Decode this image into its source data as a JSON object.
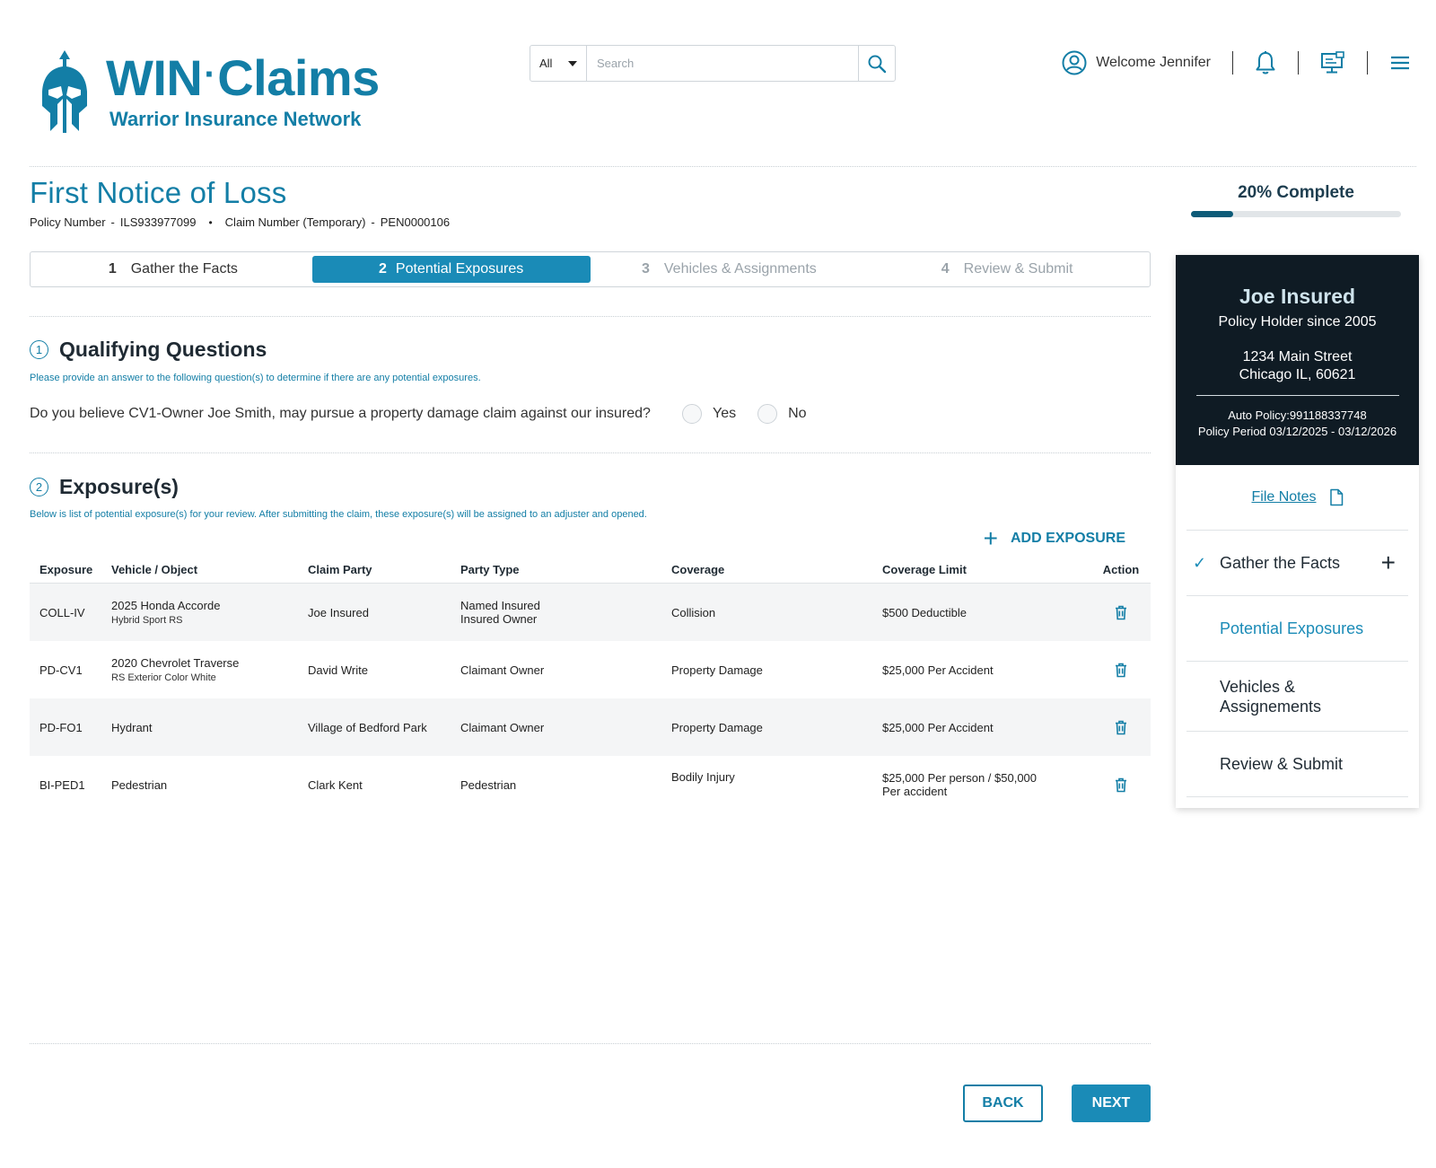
{
  "brand": {
    "title_a": "WIN",
    "title_dot": "·",
    "title_b": "Claims",
    "subtitle": "Warrior Insurance Network",
    "color": "#137ea6"
  },
  "search": {
    "scope": "All",
    "placeholder": "Search",
    "icon": "search-icon"
  },
  "user": {
    "welcome": "Welcome Jennifer",
    "icons": [
      "user-circle-icon",
      "bell-icon",
      "desktop-icon",
      "hamburger-menu-icon"
    ]
  },
  "page": {
    "title": "First Notice of Loss",
    "policy_label": "Policy Number",
    "policy_sep": "-",
    "policy_value": "ILS933977099",
    "bullet": "•",
    "claim_label": "Claim Number (Temporary)",
    "claim_sep": "-",
    "claim_value": "PEN0000106"
  },
  "progress": {
    "label": "20% Complete",
    "percent": 20
  },
  "stepper": [
    {
      "num": "1",
      "label": "Gather the Facts",
      "state": "done"
    },
    {
      "num": "2",
      "label": "Potential Exposures",
      "state": "active"
    },
    {
      "num": "3",
      "label": "Vehicles & Assignments",
      "state": "inactive"
    },
    {
      "num": "4",
      "label": "Review & Submit",
      "state": "inactive"
    }
  ],
  "qualifying": {
    "num": "1",
    "title": "Qualifying Questions",
    "description": "Please provide an answer to the following question(s) to determine if there are any potential exposures.",
    "question": "Do you believe CV1-Owner Joe Smith, may pursue a property damage claim against our insured?",
    "options": [
      "Yes",
      "No"
    ],
    "selected": null
  },
  "exposures": {
    "num": "2",
    "title": "Exposure(s)",
    "description": "Below is list of potential exposure(s) for your review. After submitting the claim, these exposure(s) will be assigned to an adjuster and opened.",
    "add_label": "ADD EXPOSURE",
    "columns": [
      "Exposure",
      "Vehicle / Object",
      "Claim Party",
      "Party Type",
      "Coverage",
      "Coverage Limit",
      "Action"
    ],
    "rows": [
      {
        "exposure": "COLL-IV",
        "vehicle": "2025 Honda Accorde",
        "vehicle_sub": "Hybrid Sport RS",
        "party": "Joe Insured",
        "ptype": "Named Insured",
        "ptype_2": "Insured Owner",
        "coverage": "Collision",
        "limit": "$500 Deductible",
        "limit_2": ""
      },
      {
        "exposure": "PD-CV1",
        "vehicle": "2020 Chevrolet Traverse",
        "vehicle_sub": "RS Exterior Color White",
        "party": "David Write",
        "ptype": "Claimant Owner",
        "ptype_2": "",
        "coverage": "Property Damage",
        "limit": "$25,000 Per Accident",
        "limit_2": ""
      },
      {
        "exposure": "PD-FO1",
        "vehicle": "Hydrant",
        "vehicle_sub": "",
        "party": "Village of Bedford Park",
        "ptype": "Claimant Owner",
        "ptype_2": "",
        "coverage": "Property Damage",
        "limit": "$25,000 Per Accident",
        "limit_2": ""
      },
      {
        "exposure": "BI-PED1",
        "vehicle": "Pedestrian",
        "vehicle_sub": "",
        "party": "Clark Kent",
        "ptype": "Pedestrian",
        "ptype_2": "",
        "coverage": "Bodily Injury",
        "limit": "$25,000 Per person / $50,000",
        "limit_2": "Per accident"
      }
    ]
  },
  "footer": {
    "back": "BACK",
    "next": "NEXT"
  },
  "sidebar": {
    "name": "Joe Insured",
    "since": "Policy Holder since 2005",
    "address_1": "1234 Main Street",
    "address_2": "Chicago IL, 60621",
    "auto_policy": "Auto Policy:991188337748",
    "policy_period": "Policy Period 03/12/2025 - 03/12/2026",
    "file_notes": "File Notes",
    "items": [
      {
        "label": "Gather the Facts",
        "state": "done"
      },
      {
        "label": "Potential Exposures",
        "state": "current"
      },
      {
        "label": "Vehicles & Assignements",
        "state": "pending"
      },
      {
        "label": "Review & Submit",
        "state": "pending"
      }
    ]
  },
  "colors": {
    "accent": "#137ea6",
    "active_step": "#1a8bb7",
    "progress_fill": "#0d5b78",
    "side_dark": "#0f1b24"
  }
}
